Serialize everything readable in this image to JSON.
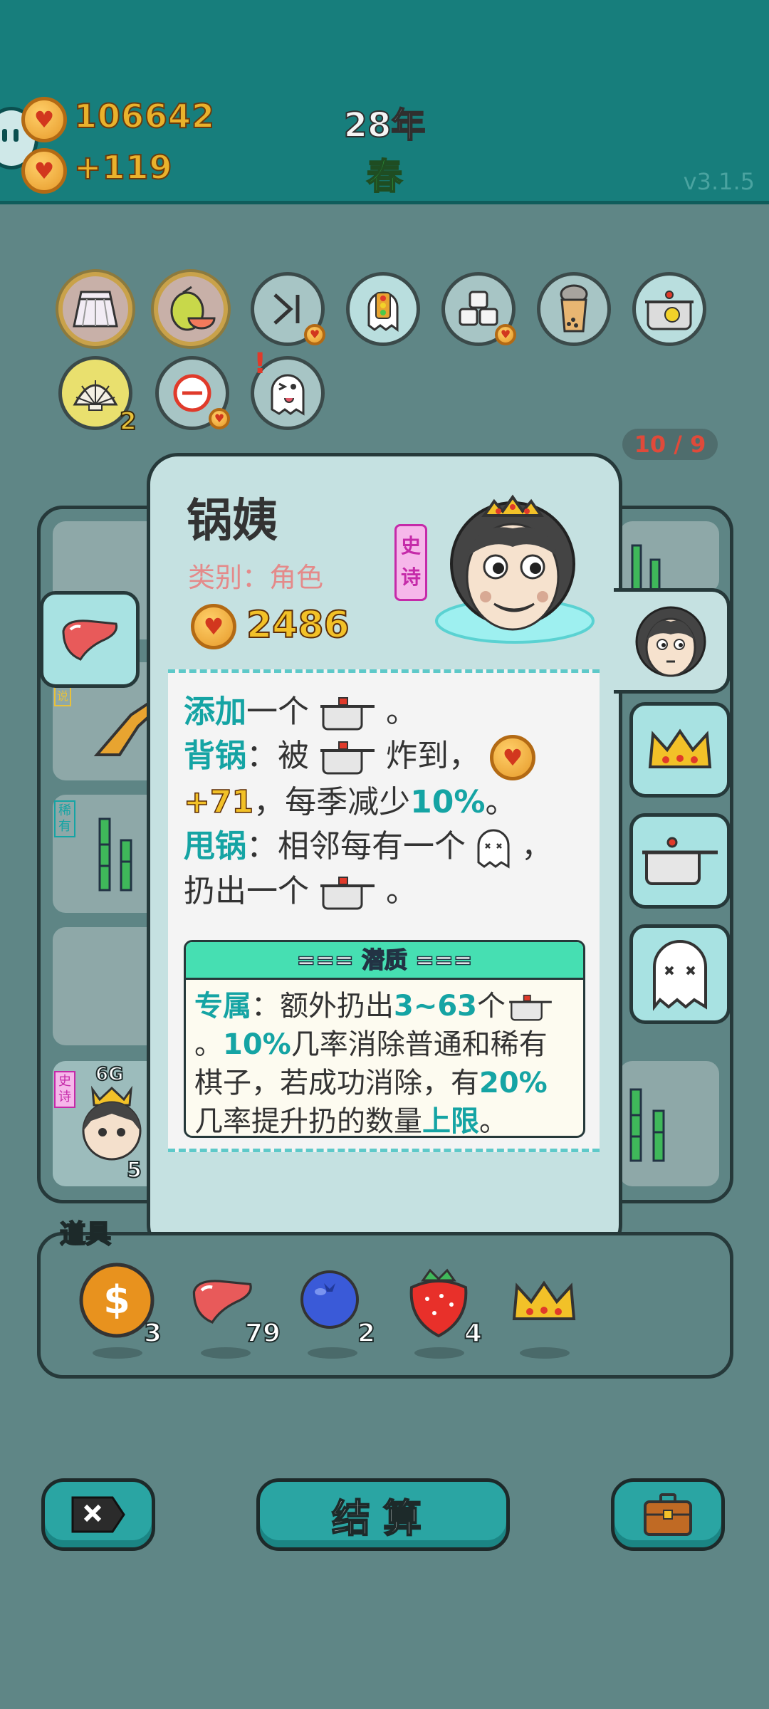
{
  "header": {
    "coins": "106642",
    "income": "+119",
    "year": "28年",
    "season": "春",
    "version": "v3.1.5"
  },
  "relics": [
    {
      "icon": "skirt-icon"
    },
    {
      "icon": "pomelo-icon"
    },
    {
      "icon": "skip-icon"
    },
    {
      "icon": "traffic-light-ghost-icon"
    },
    {
      "icon": "sugar-cubes-icon"
    },
    {
      "icon": "bubble-tea-icon"
    },
    {
      "icon": "duck-pot-icon"
    },
    {
      "icon": "shell-icon",
      "count": "2"
    },
    {
      "icon": "minus-icon"
    },
    {
      "icon": "winking-ghost-icon"
    }
  ],
  "board": {
    "counter": "10 / 9",
    "left_tags": [
      "说",
      "稀有",
      "史诗"
    ],
    "bottom_left_counts": [
      "6G",
      "5"
    ]
  },
  "card": {
    "name": "锅姨",
    "category": "类别：角色",
    "price": "2486",
    "rarity": "史诗",
    "desc_lines": {
      "l1_kw": "添加",
      "l1_rest": "一个",
      "l1_end": "。",
      "l2_kw": "背锅",
      "l2_rest": "：被",
      "l2_end": "炸到，",
      "l3_bonus": "+71",
      "l3_rest": "，每季减少",
      "l3_pct": "10%",
      "l3_end": "。",
      "l4_kw": "甩锅",
      "l4_rest": "：相邻每有一个",
      "l4_end": "，",
      "l5_rest": "扔出一个",
      "l5_end": "。"
    },
    "potential": {
      "title": "=== 潜质 ===",
      "p1_kw": "专属",
      "p1_text": "：额外扔出",
      "p1_range": "3~63",
      "p1_unit": "个",
      "p2_start": "。",
      "p2_pct": "10%",
      "p2_text": "几率消除普通和稀有棋子，若成功消除，有",
      "p2_pct2": "20%",
      "p2_text2": "几率提升扔的数量",
      "p2_kw": "上限",
      "p2_end": "。"
    }
  },
  "items": {
    "label": "道具",
    "list": [
      {
        "icon": "dollar-coin-icon",
        "count": "3"
      },
      {
        "icon": "liver-icon",
        "count": "79"
      },
      {
        "icon": "blueberry-icon",
        "count": "2"
      },
      {
        "icon": "strawberry-icon",
        "count": "4"
      },
      {
        "icon": "crown-icon",
        "count": ""
      }
    ]
  },
  "buttons": {
    "settle": "结算"
  }
}
